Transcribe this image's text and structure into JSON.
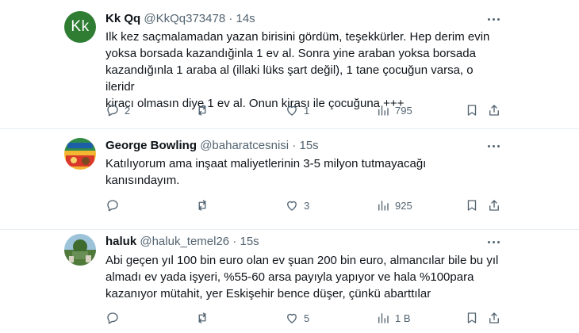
{
  "tweets": [
    {
      "avatar_text": "Kk",
      "name": "Kk Qq",
      "handle": "@KkQq373478",
      "separator": "·",
      "time": "14s",
      "text": "Ilk kez saçmalamadan yazan birisini gördüm, teşekkürler. Hep derim evin\nyoksa borsada kazandığinla 1 ev al. Sonra yine araban yoksa borsada\nkazandığınla 1 araba al (illaki lüks şart değil), 1 tane çocuğun varsa, o ileridr\nkiracı olmasın diye 1 ev al. Onun kirası ile çocuğuna +++",
      "replies": "2",
      "retweets": "",
      "likes": "1",
      "views": "795"
    },
    {
      "name": "George Bowling",
      "handle": "@baharatcesnisi",
      "separator": "·",
      "time": "15s",
      "text": "Katılıyorum ama inşaat maliyetlerinin 3-5 milyon tutmayacağı\nkanısındayım.",
      "replies": "",
      "retweets": "",
      "likes": "3",
      "views": "925"
    },
    {
      "name": "haluk",
      "handle": "@haluk_temel26",
      "separator": "·",
      "time": "15s",
      "text": "Abi geçen yıl 100 bin euro olan ev şuan 200 bin euro, almancılar bile bu yıl\nalmadı ev yada işyeri, %55-60 arsa payıyla yapıyor ve hala %100para\nkazanıyor mütahit, yer Eskişehir bence düşer, çünkü abarttılar",
      "replies": "",
      "retweets": "",
      "likes": "5",
      "views": "1 B"
    }
  ],
  "colors": {
    "text": "#0f1419",
    "secondary": "#536471",
    "divider": "#e6ecf0",
    "kk_avatar": "#2f7d32"
  },
  "icons": [
    "reply-icon",
    "retweet-icon",
    "like-icon",
    "views-icon",
    "bookmark-icon",
    "share-icon",
    "more-icon"
  ]
}
